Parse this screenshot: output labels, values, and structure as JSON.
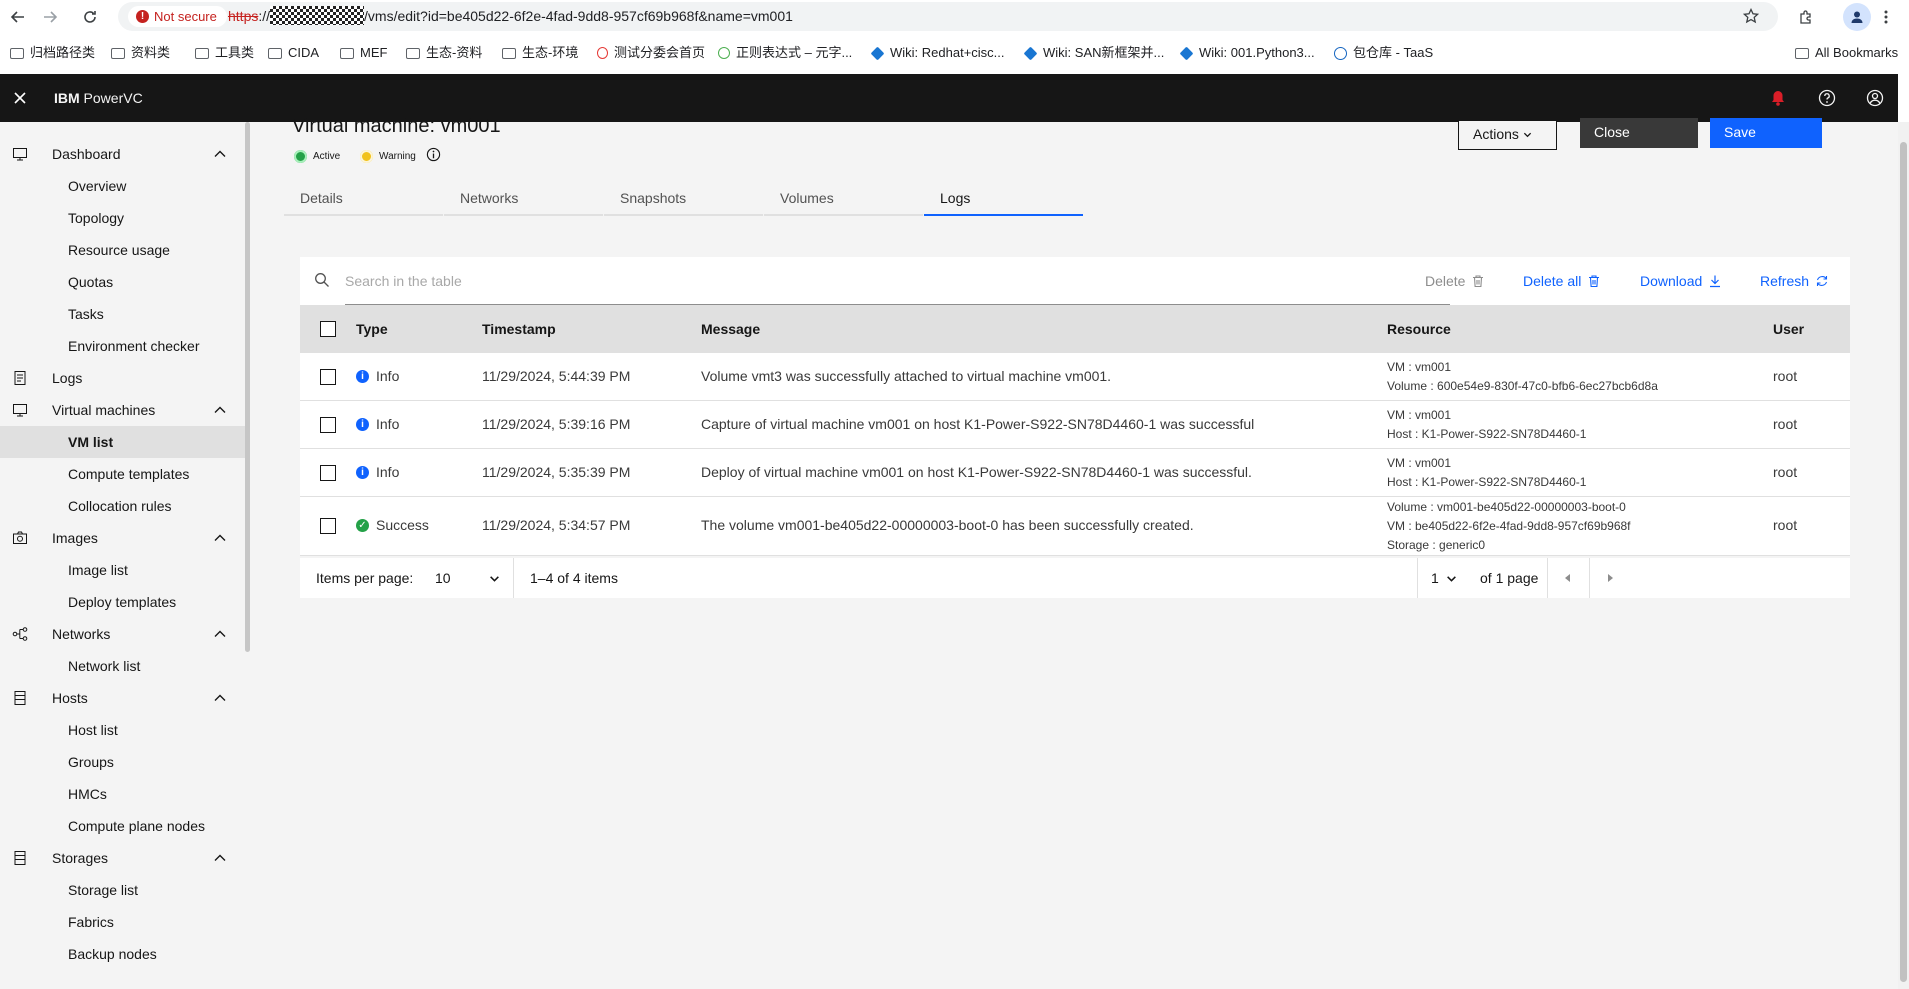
{
  "browser": {
    "not_secure": "Not secure",
    "url_scheme": "https",
    "url_sep": "://",
    "url_rest": "/vms/edit?id=be405d22-6f2e-4fad-9dd8-957cf69b968f&name=vm001",
    "bookmarks": [
      "归档路径类",
      "资料类",
      "工具类",
      "CIDA",
      "MEF",
      "生态-资料",
      "生态-环境",
      "测试分委会首页",
      "正则表达式 – 元字...",
      "Wiki: Redhat+cisc...",
      "Wiki: SAN新框架并...",
      "Wiki: 001.Python3...",
      "包仓库 - TaaS"
    ],
    "all_bookmarks": "All Bookmarks"
  },
  "app": {
    "brand": "IBM",
    "product": " PowerVC",
    "notification_color": "#da1e28"
  },
  "nav": {
    "dashboard": "Dashboard",
    "overview": "Overview",
    "topology": "Topology",
    "resource_usage": "Resource usage",
    "quotas": "Quotas",
    "tasks": "Tasks",
    "environment_checker": "Environment checker",
    "logs": "Logs",
    "virtual_machines": "Virtual machines",
    "vm_list": "VM list",
    "compute_templates": "Compute templates",
    "collocation_rules": "Collocation rules",
    "images": "Images",
    "image_list": "Image list",
    "deploy_templates": "Deploy templates",
    "networks": "Networks",
    "network_list": "Network list",
    "hosts": "Hosts",
    "host_list": "Host list",
    "groups": "Groups",
    "hmcs": "HMCs",
    "compute_plane_nodes": "Compute plane nodes",
    "storages": "Storages",
    "storage_list": "Storage list",
    "fabrics": "Fabrics",
    "backup_nodes": "Backup nodes"
  },
  "page": {
    "title": "Virtual machine: vm001",
    "status_active": "Active",
    "status_warning": "Warning",
    "active_color": "#24a148",
    "warning_color": "#f1c21b",
    "actions": "Actions",
    "close": "Close",
    "save": "Save",
    "tabs": [
      "Details",
      "Networks",
      "Snapshots",
      "Volumes",
      "Logs"
    ],
    "active_tab": "Logs"
  },
  "table": {
    "search_placeholder": "Search in the table",
    "delete": "Delete",
    "delete_all": "Delete all",
    "download": "Download",
    "refresh": "Refresh",
    "headers": [
      "Type",
      "Timestamp",
      "Message",
      "Resource",
      "User"
    ],
    "rows": [
      {
        "type": "Info",
        "timestamp": "11/29/2024, 5:44:39 PM",
        "message": "Volume vmt3 was successfully attached to virtual machine vm001.",
        "resource": [
          "VM : vm001",
          "Volume : 600e54e9-830f-47c0-bfb6-6ec27bcb6d8a"
        ],
        "user": "root"
      },
      {
        "type": "Info",
        "timestamp": "11/29/2024, 5:39:16 PM",
        "message": "Capture of virtual machine vm001 on host K1-Power-S922-SN78D4460-1 was successful",
        "resource": [
          "VM : vm001",
          "Host : K1-Power-S922-SN78D4460-1"
        ],
        "user": "root"
      },
      {
        "type": "Info",
        "timestamp": "11/29/2024, 5:35:39 PM",
        "message": "Deploy of virtual machine vm001 on host K1-Power-S922-SN78D4460-1 was successful.",
        "resource": [
          "VM : vm001",
          "Host : K1-Power-S922-SN78D4460-1"
        ],
        "user": "root"
      },
      {
        "type": "Success",
        "timestamp": "11/29/2024, 5:34:57 PM",
        "message": "The volume vm001-be405d22-00000003-boot-0 has been successfully created.",
        "resource": [
          "Volume : vm001-be405d22-00000003-boot-0",
          "VM : be405d22-6f2e-4fad-9dd8-957cf69b968f",
          "Storage : generic0"
        ],
        "user": "root"
      }
    ],
    "info_color": "#0f62fe",
    "success_color": "#24a148"
  },
  "pagination": {
    "items_per_page_label": "Items per page:",
    "items_per_page": "10",
    "range": "1–4 of 4 items",
    "page": "1",
    "of_pages": "of 1 page"
  }
}
